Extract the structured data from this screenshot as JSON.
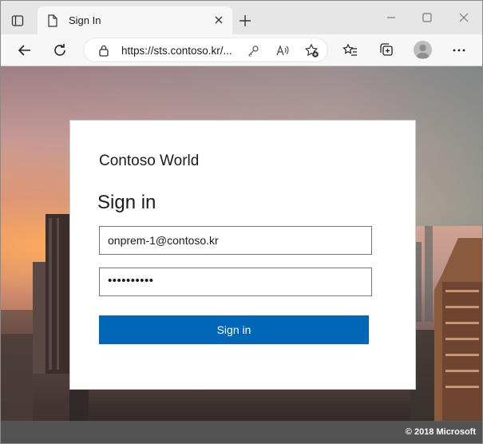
{
  "browser": {
    "tab": {
      "title": "Sign In"
    },
    "address_bar": {
      "url": "https://sts.contoso.kr/..."
    },
    "icons": [
      "tab-actions-icon",
      "document-icon",
      "close-icon",
      "plus-icon",
      "minimize-icon",
      "maximize-icon",
      "close-window-icon",
      "back-arrow-icon",
      "refresh-icon",
      "lock-icon",
      "key-icon",
      "read-aloud-icon",
      "favorite-add-icon",
      "favorites-icon",
      "collections-icon",
      "profile-icon",
      "more-icon"
    ]
  },
  "login": {
    "company_name": "Contoso World",
    "heading": "Sign in",
    "username": "onprem-1@contoso.kr",
    "password_masked": "••••••••••",
    "submit_label": "Sign in"
  },
  "footer": {
    "copyright": "© 2018 Microsoft"
  },
  "colors": {
    "primary_button": "#0067b8",
    "tabstrip": "#e6e6e6",
    "toolbar": "#f7f7f7",
    "footer": "#5a5a5a"
  }
}
